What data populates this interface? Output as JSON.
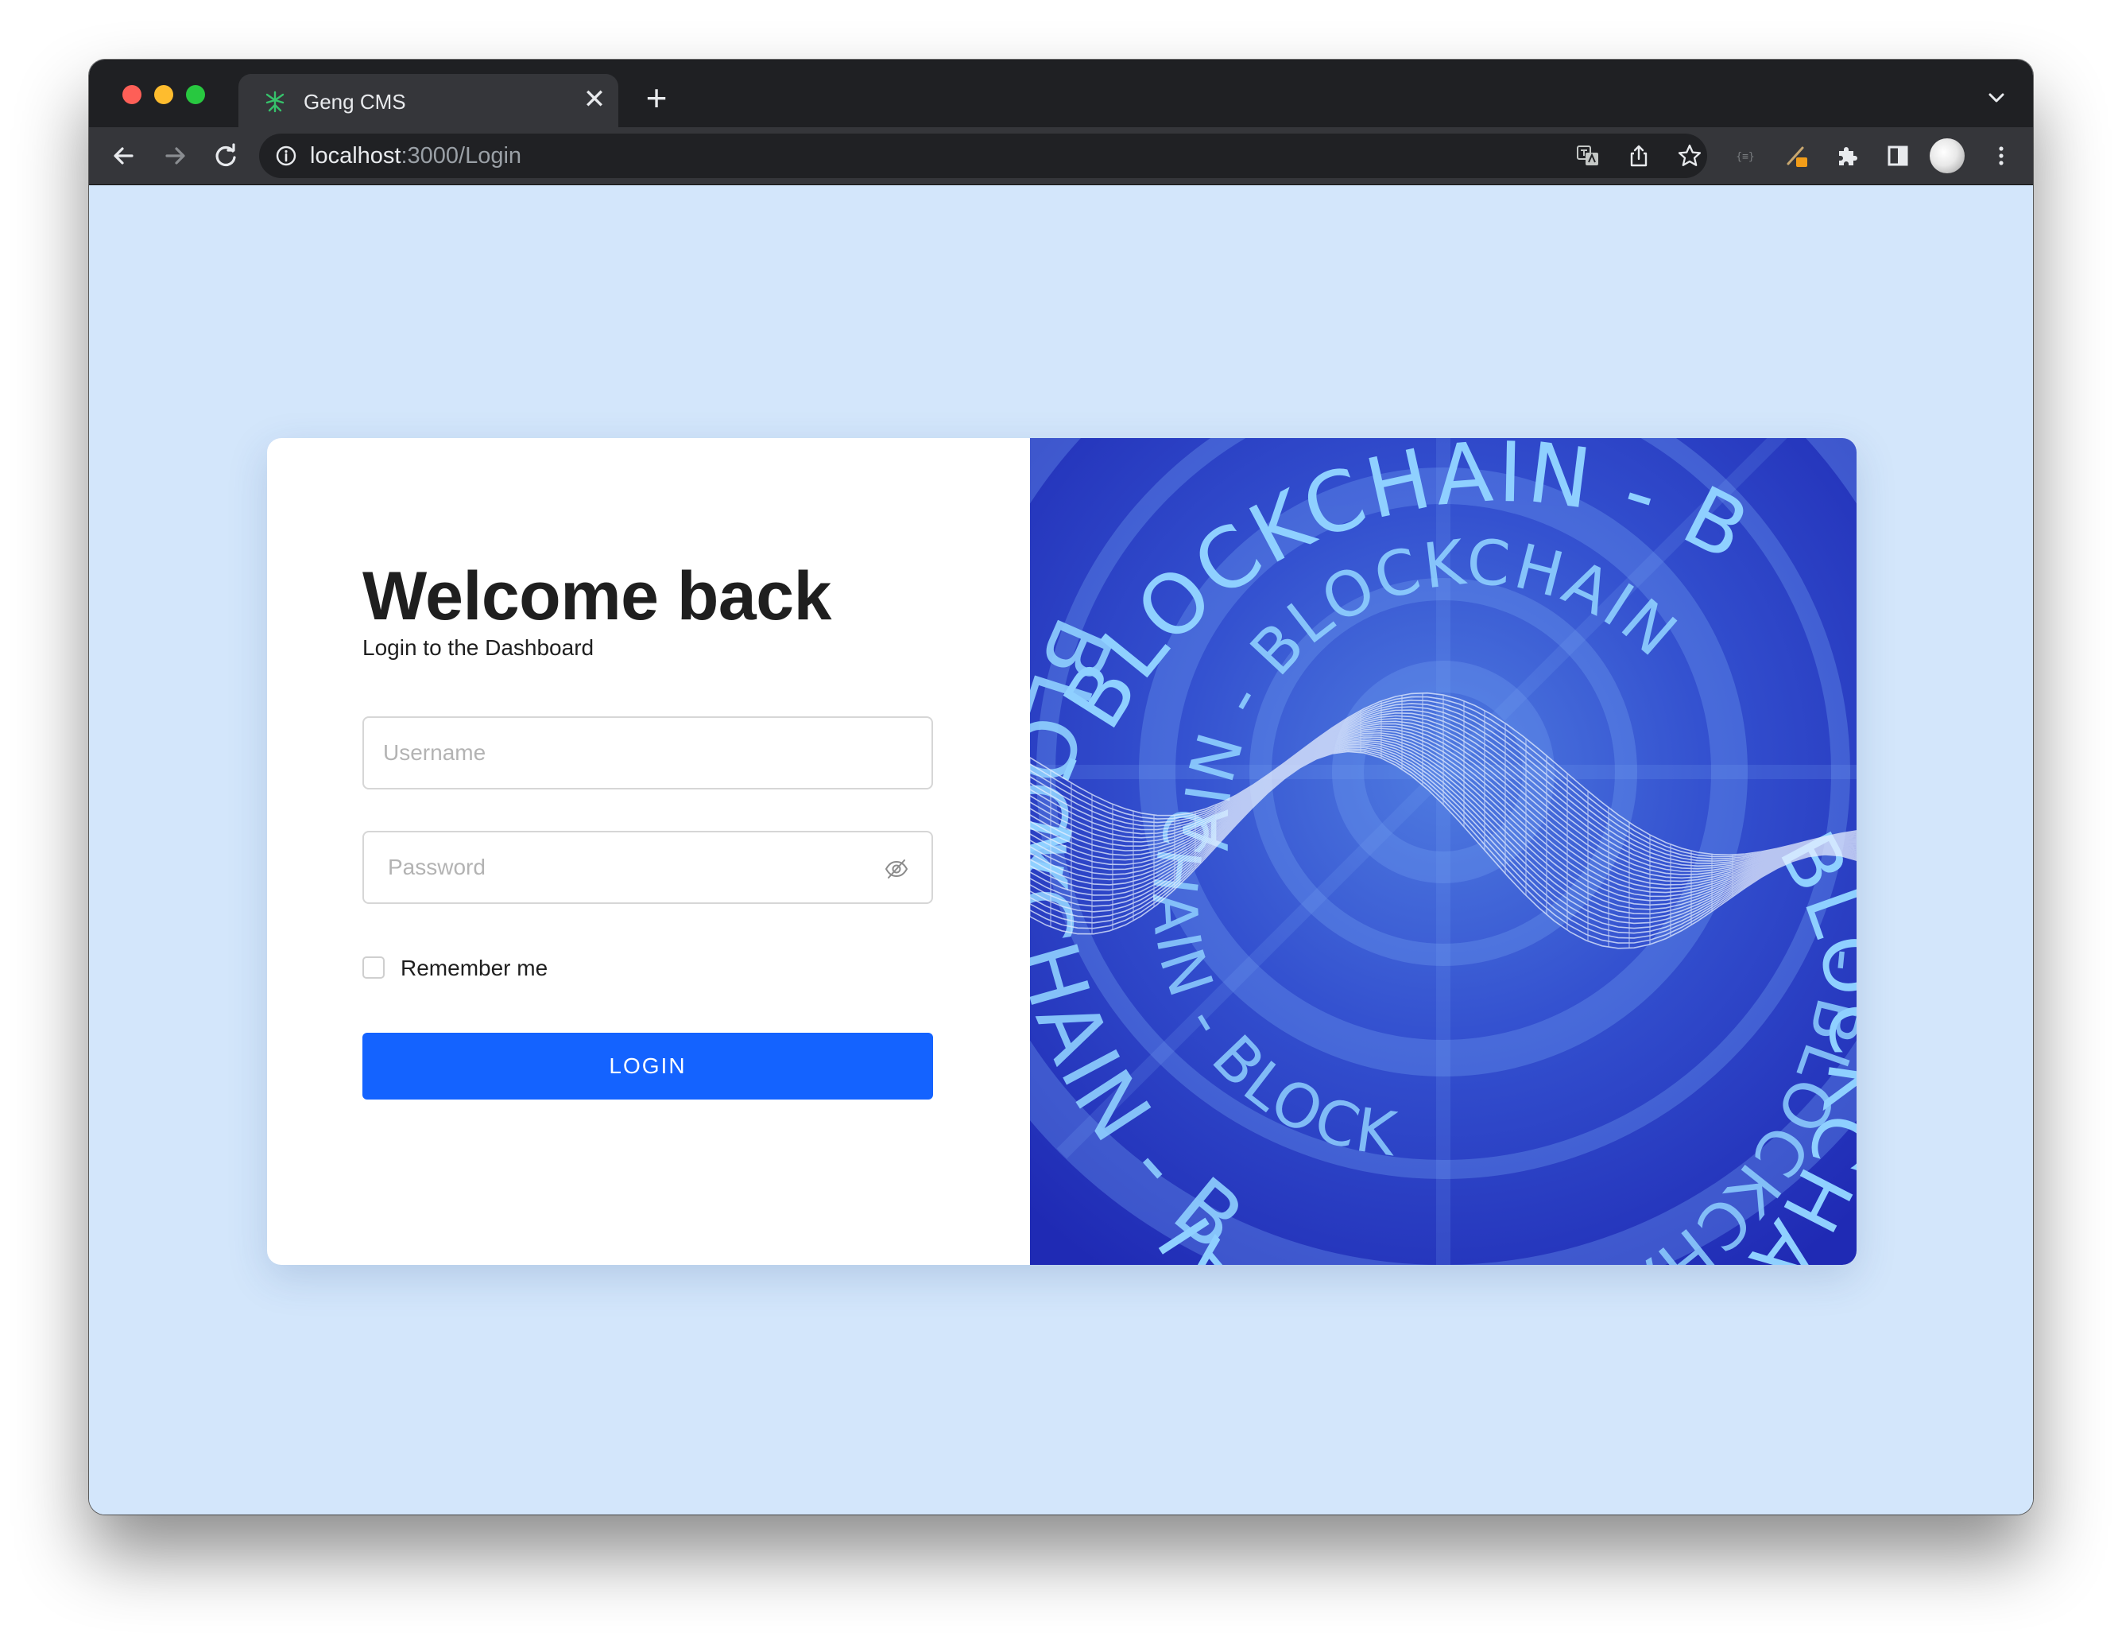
{
  "browser": {
    "tab": {
      "title": "Geng CMS",
      "favicon": "geng-cms-favicon",
      "close_glyph": "✕"
    },
    "new_tab_glyph": "+",
    "address_bar": {
      "host": "localhost",
      "path": ":3000/Login"
    },
    "toolbar_icons": [
      "back-icon",
      "forward-icon",
      "reload-icon",
      "info-icon",
      "translate-icon",
      "share-icon",
      "star-icon",
      "extension-braces-icon",
      "extension-pen-icon",
      "puzzle-icon",
      "sidebar-icon",
      "profile-avatar",
      "menu-icon"
    ]
  },
  "login": {
    "title": "Welcome back",
    "subtitle": "Login to the Dashboard",
    "username": {
      "value": "",
      "placeholder": "Username"
    },
    "password": {
      "value": "",
      "placeholder": "Password"
    },
    "remember_label": "Remember me",
    "remember_checked": false,
    "button_label": "LOGIN"
  },
  "hero": {
    "word": "BLOCKCHAIN"
  },
  "colors": {
    "page_background": "#d3e6fb",
    "primary": "#1463ff",
    "hero_blue": "#2a3fc4",
    "hero_text": "#8fd0ff"
  }
}
